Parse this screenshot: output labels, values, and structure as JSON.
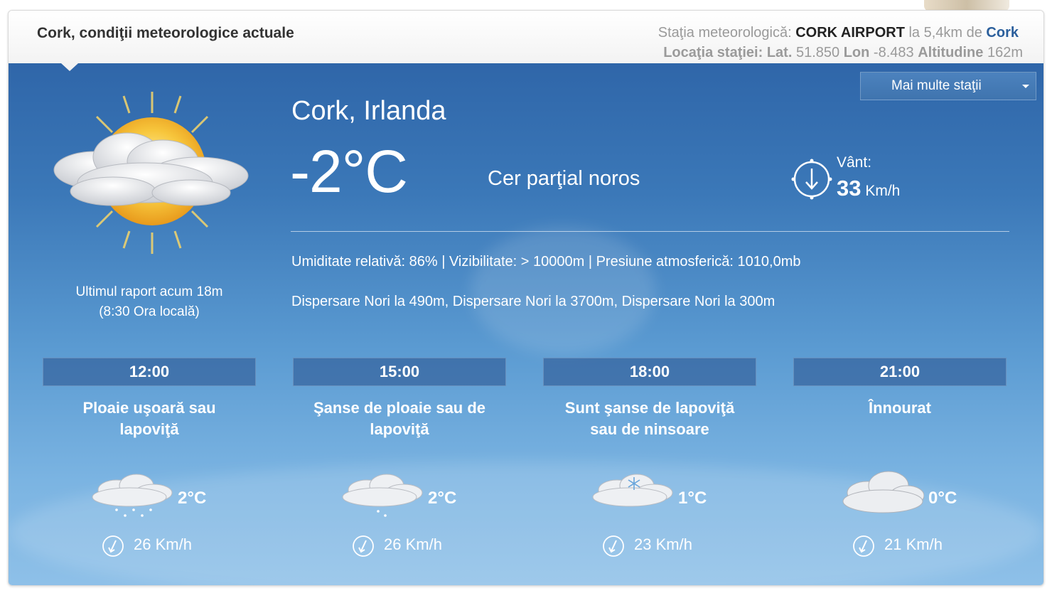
{
  "header": {
    "title": "Cork, condiţii meteorologice actuale",
    "station_label": "Staţia meteorologică:",
    "station_name": "CORK AIRPORT",
    "station_distance": "la 5,4km de",
    "station_city": "Cork",
    "location_label": "Locaţia staţiei:",
    "lat_label": "Lat.",
    "lat_value": "51.850",
    "lon_label": "Lon",
    "lon_value": "-8.483",
    "alt_label": "Altitudine",
    "alt_value": "162m"
  },
  "more_stations": {
    "label": "Mai multe staţii"
  },
  "current": {
    "icon": "partly-cloudy-sun-icon",
    "last_report_line1": "Ultimul raport acum 18m",
    "last_report_line2": "(8:30 Ora locală)",
    "city": "Cork, Irlanda",
    "temperature": "-2°C",
    "condition": "Cer parţial noros",
    "wind_label": "Vânt:",
    "wind_speed": "33",
    "wind_unit": "Km/h",
    "details": "Umiditate relativă: 86% | Vizibilitate: > 10000m | Presiune atmosferică: 1010,0mb",
    "clouds": "Dispersare Nori la 490m, Dispersare Nori la 3700m, Dispersare Nori la 300m"
  },
  "forecast": [
    {
      "time": "12:00",
      "desc_line1": "Ploaie uşoară sau",
      "desc_line2": "lapoviţă",
      "icon": "cloud-rain-icon",
      "temp": "2°C",
      "wind": "26 Km/h"
    },
    {
      "time": "15:00",
      "desc_line1": "Şanse de ploaie sau de",
      "desc_line2": "lapoviţă",
      "icon": "cloud-rain-icon",
      "temp": "2°C",
      "wind": "26 Km/h"
    },
    {
      "time": "18:00",
      "desc_line1": "Sunt şanse de lapoviţă",
      "desc_line2": "sau de ninsoare",
      "icon": "cloud-snow-icon",
      "temp": "1°C",
      "wind": "23 Km/h"
    },
    {
      "time": "21:00",
      "desc_line1": "Înnourat",
      "desc_line2": "",
      "icon": "cloud-icon",
      "temp": "0°C",
      "wind": "21 Km/h"
    }
  ],
  "colors": {
    "panel_top": "#2f66a9",
    "panel_bottom": "#8ec0e8",
    "link": "#2b5f9c"
  }
}
